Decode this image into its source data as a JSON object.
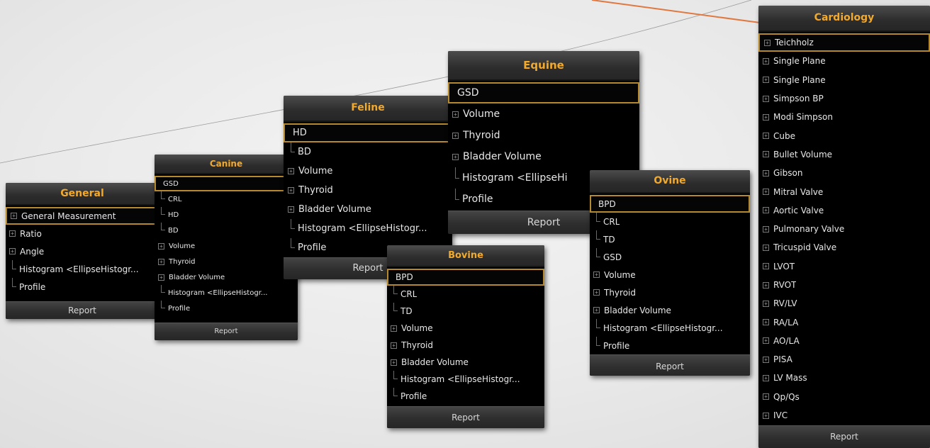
{
  "panels": {
    "general": {
      "title": "General",
      "report": "Report",
      "items": [
        {
          "label": "General Measurement",
          "type": "expand",
          "selected": true
        },
        {
          "label": "Ratio",
          "type": "expand"
        },
        {
          "label": "Angle",
          "type": "expand"
        },
        {
          "label": "Histogram <EllipseHistogr...",
          "type": "leaf"
        },
        {
          "label": "Profile",
          "type": "leaf"
        }
      ]
    },
    "canine": {
      "title": "Canine",
      "report": "Report",
      "items": [
        {
          "label": "GSD",
          "type": "plain",
          "selected": true
        },
        {
          "label": "CRL",
          "type": "leaf"
        },
        {
          "label": "HD",
          "type": "leaf"
        },
        {
          "label": "BD",
          "type": "leaf"
        },
        {
          "label": "Volume",
          "type": "expand"
        },
        {
          "label": "Thyroid",
          "type": "expand"
        },
        {
          "label": "Bladder Volume",
          "type": "expand"
        },
        {
          "label": "Histogram <EllipseHistogr...",
          "type": "leaf"
        },
        {
          "label": "Profile",
          "type": "leaf"
        }
      ]
    },
    "feline": {
      "title": "Feline",
      "report": "Report",
      "items": [
        {
          "label": "HD",
          "type": "plain",
          "selected": true
        },
        {
          "label": "BD",
          "type": "leaf"
        },
        {
          "label": "Volume",
          "type": "expand"
        },
        {
          "label": "Thyroid",
          "type": "expand"
        },
        {
          "label": "Bladder Volume",
          "type": "expand"
        },
        {
          "label": "Histogram <EllipseHistogr...",
          "type": "leaf"
        },
        {
          "label": "Profile",
          "type": "leaf"
        }
      ]
    },
    "equine": {
      "title": "Equine",
      "report": "Report",
      "items": [
        {
          "label": "GSD",
          "type": "plain",
          "selected": true
        },
        {
          "label": "Volume",
          "type": "expand"
        },
        {
          "label": "Thyroid",
          "type": "expand"
        },
        {
          "label": "Bladder Volume",
          "type": "expand"
        },
        {
          "label": "Histogram <EllipseHi",
          "type": "leaf"
        },
        {
          "label": "Profile",
          "type": "leaf"
        }
      ]
    },
    "bovine": {
      "title": "Bovine",
      "report": "Report",
      "items": [
        {
          "label": "BPD",
          "type": "plain",
          "selected": true
        },
        {
          "label": "CRL",
          "type": "leaf"
        },
        {
          "label": "TD",
          "type": "leaf"
        },
        {
          "label": "Volume",
          "type": "expand"
        },
        {
          "label": "Thyroid",
          "type": "expand"
        },
        {
          "label": "Bladder Volume",
          "type": "expand"
        },
        {
          "label": "Histogram <EllipseHistogr...",
          "type": "leaf"
        },
        {
          "label": "Profile",
          "type": "leaf"
        }
      ]
    },
    "ovine": {
      "title": "Ovine",
      "report": "Report",
      "items": [
        {
          "label": "BPD",
          "type": "plain",
          "selected": true
        },
        {
          "label": "CRL",
          "type": "leaf"
        },
        {
          "label": "TD",
          "type": "leaf"
        },
        {
          "label": "GSD",
          "type": "leaf"
        },
        {
          "label": "Volume",
          "type": "expand"
        },
        {
          "label": "Thyroid",
          "type": "expand"
        },
        {
          "label": "Bladder Volume",
          "type": "expand"
        },
        {
          "label": "Histogram <EllipseHistogr...",
          "type": "leaf"
        },
        {
          "label": "Profile",
          "type": "leaf"
        }
      ]
    },
    "cardiology": {
      "title": "Cardiology",
      "report": "Report",
      "items": [
        {
          "label": "Teichholz",
          "type": "expand",
          "selected": true
        },
        {
          "label": "Single Plane",
          "type": "expand"
        },
        {
          "label": "Single Plane",
          "type": "expand"
        },
        {
          "label": "Simpson BP",
          "type": "expand"
        },
        {
          "label": "Modi Simpson",
          "type": "expand"
        },
        {
          "label": "Cube",
          "type": "expand"
        },
        {
          "label": "Bullet Volume",
          "type": "expand"
        },
        {
          "label": "Gibson",
          "type": "expand"
        },
        {
          "label": "Mitral Valve",
          "type": "expand"
        },
        {
          "label": "Aortic Valve",
          "type": "expand"
        },
        {
          "label": "Pulmonary Valve",
          "type": "expand"
        },
        {
          "label": "Tricuspid Valve",
          "type": "expand"
        },
        {
          "label": "LVOT",
          "type": "expand"
        },
        {
          "label": "RVOT",
          "type": "expand"
        },
        {
          "label": "RV/LV",
          "type": "expand"
        },
        {
          "label": "RA/LA",
          "type": "expand"
        },
        {
          "label": "AO/LA",
          "type": "expand"
        },
        {
          "label": "PISA",
          "type": "expand"
        },
        {
          "label": "LV Mass",
          "type": "expand"
        },
        {
          "label": "Qp/Qs",
          "type": "expand"
        },
        {
          "label": "IVC",
          "type": "expand"
        }
      ]
    }
  },
  "colors": {
    "title_accent": "#f3a92a",
    "selection_border": "#b5892e",
    "arc_line": "#e07840"
  }
}
